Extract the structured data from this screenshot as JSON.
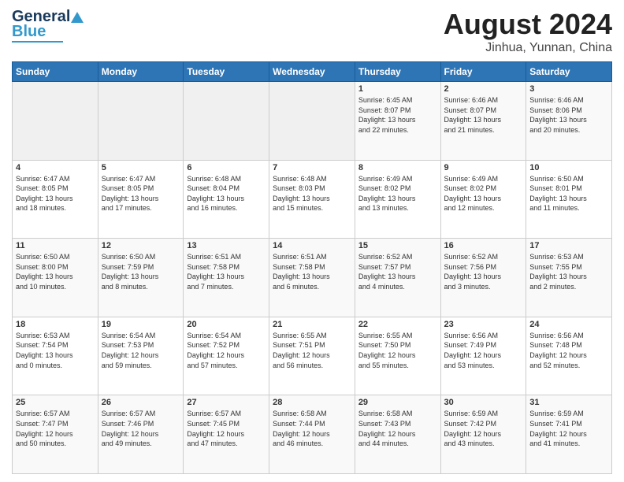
{
  "logo": {
    "line1": "General",
    "line2": "Blue"
  },
  "title": "August 2024",
  "subtitle": "Jinhua, Yunnan, China",
  "days": [
    "Sunday",
    "Monday",
    "Tuesday",
    "Wednesday",
    "Thursday",
    "Friday",
    "Saturday"
  ],
  "weeks": [
    [
      {
        "num": "",
        "info": ""
      },
      {
        "num": "",
        "info": ""
      },
      {
        "num": "",
        "info": ""
      },
      {
        "num": "",
        "info": ""
      },
      {
        "num": "1",
        "info": "Sunrise: 6:45 AM\nSunset: 8:07 PM\nDaylight: 13 hours\nand 22 minutes."
      },
      {
        "num": "2",
        "info": "Sunrise: 6:46 AM\nSunset: 8:07 PM\nDaylight: 13 hours\nand 21 minutes."
      },
      {
        "num": "3",
        "info": "Sunrise: 6:46 AM\nSunset: 8:06 PM\nDaylight: 13 hours\nand 20 minutes."
      }
    ],
    [
      {
        "num": "4",
        "info": "Sunrise: 6:47 AM\nSunset: 8:05 PM\nDaylight: 13 hours\nand 18 minutes."
      },
      {
        "num": "5",
        "info": "Sunrise: 6:47 AM\nSunset: 8:05 PM\nDaylight: 13 hours\nand 17 minutes."
      },
      {
        "num": "6",
        "info": "Sunrise: 6:48 AM\nSunset: 8:04 PM\nDaylight: 13 hours\nand 16 minutes."
      },
      {
        "num": "7",
        "info": "Sunrise: 6:48 AM\nSunset: 8:03 PM\nDaylight: 13 hours\nand 15 minutes."
      },
      {
        "num": "8",
        "info": "Sunrise: 6:49 AM\nSunset: 8:02 PM\nDaylight: 13 hours\nand 13 minutes."
      },
      {
        "num": "9",
        "info": "Sunrise: 6:49 AM\nSunset: 8:02 PM\nDaylight: 13 hours\nand 12 minutes."
      },
      {
        "num": "10",
        "info": "Sunrise: 6:50 AM\nSunset: 8:01 PM\nDaylight: 13 hours\nand 11 minutes."
      }
    ],
    [
      {
        "num": "11",
        "info": "Sunrise: 6:50 AM\nSunset: 8:00 PM\nDaylight: 13 hours\nand 10 minutes."
      },
      {
        "num": "12",
        "info": "Sunrise: 6:50 AM\nSunset: 7:59 PM\nDaylight: 13 hours\nand 8 minutes."
      },
      {
        "num": "13",
        "info": "Sunrise: 6:51 AM\nSunset: 7:58 PM\nDaylight: 13 hours\nand 7 minutes."
      },
      {
        "num": "14",
        "info": "Sunrise: 6:51 AM\nSunset: 7:58 PM\nDaylight: 13 hours\nand 6 minutes."
      },
      {
        "num": "15",
        "info": "Sunrise: 6:52 AM\nSunset: 7:57 PM\nDaylight: 13 hours\nand 4 minutes."
      },
      {
        "num": "16",
        "info": "Sunrise: 6:52 AM\nSunset: 7:56 PM\nDaylight: 13 hours\nand 3 minutes."
      },
      {
        "num": "17",
        "info": "Sunrise: 6:53 AM\nSunset: 7:55 PM\nDaylight: 13 hours\nand 2 minutes."
      }
    ],
    [
      {
        "num": "18",
        "info": "Sunrise: 6:53 AM\nSunset: 7:54 PM\nDaylight: 13 hours\nand 0 minutes."
      },
      {
        "num": "19",
        "info": "Sunrise: 6:54 AM\nSunset: 7:53 PM\nDaylight: 12 hours\nand 59 minutes."
      },
      {
        "num": "20",
        "info": "Sunrise: 6:54 AM\nSunset: 7:52 PM\nDaylight: 12 hours\nand 57 minutes."
      },
      {
        "num": "21",
        "info": "Sunrise: 6:55 AM\nSunset: 7:51 PM\nDaylight: 12 hours\nand 56 minutes."
      },
      {
        "num": "22",
        "info": "Sunrise: 6:55 AM\nSunset: 7:50 PM\nDaylight: 12 hours\nand 55 minutes."
      },
      {
        "num": "23",
        "info": "Sunrise: 6:56 AM\nSunset: 7:49 PM\nDaylight: 12 hours\nand 53 minutes."
      },
      {
        "num": "24",
        "info": "Sunrise: 6:56 AM\nSunset: 7:48 PM\nDaylight: 12 hours\nand 52 minutes."
      }
    ],
    [
      {
        "num": "25",
        "info": "Sunrise: 6:57 AM\nSunset: 7:47 PM\nDaylight: 12 hours\nand 50 minutes."
      },
      {
        "num": "26",
        "info": "Sunrise: 6:57 AM\nSunset: 7:46 PM\nDaylight: 12 hours\nand 49 minutes."
      },
      {
        "num": "27",
        "info": "Sunrise: 6:57 AM\nSunset: 7:45 PM\nDaylight: 12 hours\nand 47 minutes."
      },
      {
        "num": "28",
        "info": "Sunrise: 6:58 AM\nSunset: 7:44 PM\nDaylight: 12 hours\nand 46 minutes."
      },
      {
        "num": "29",
        "info": "Sunrise: 6:58 AM\nSunset: 7:43 PM\nDaylight: 12 hours\nand 44 minutes."
      },
      {
        "num": "30",
        "info": "Sunrise: 6:59 AM\nSunset: 7:42 PM\nDaylight: 12 hours\nand 43 minutes."
      },
      {
        "num": "31",
        "info": "Sunrise: 6:59 AM\nSunset: 7:41 PM\nDaylight: 12 hours\nand 41 minutes."
      }
    ]
  ]
}
